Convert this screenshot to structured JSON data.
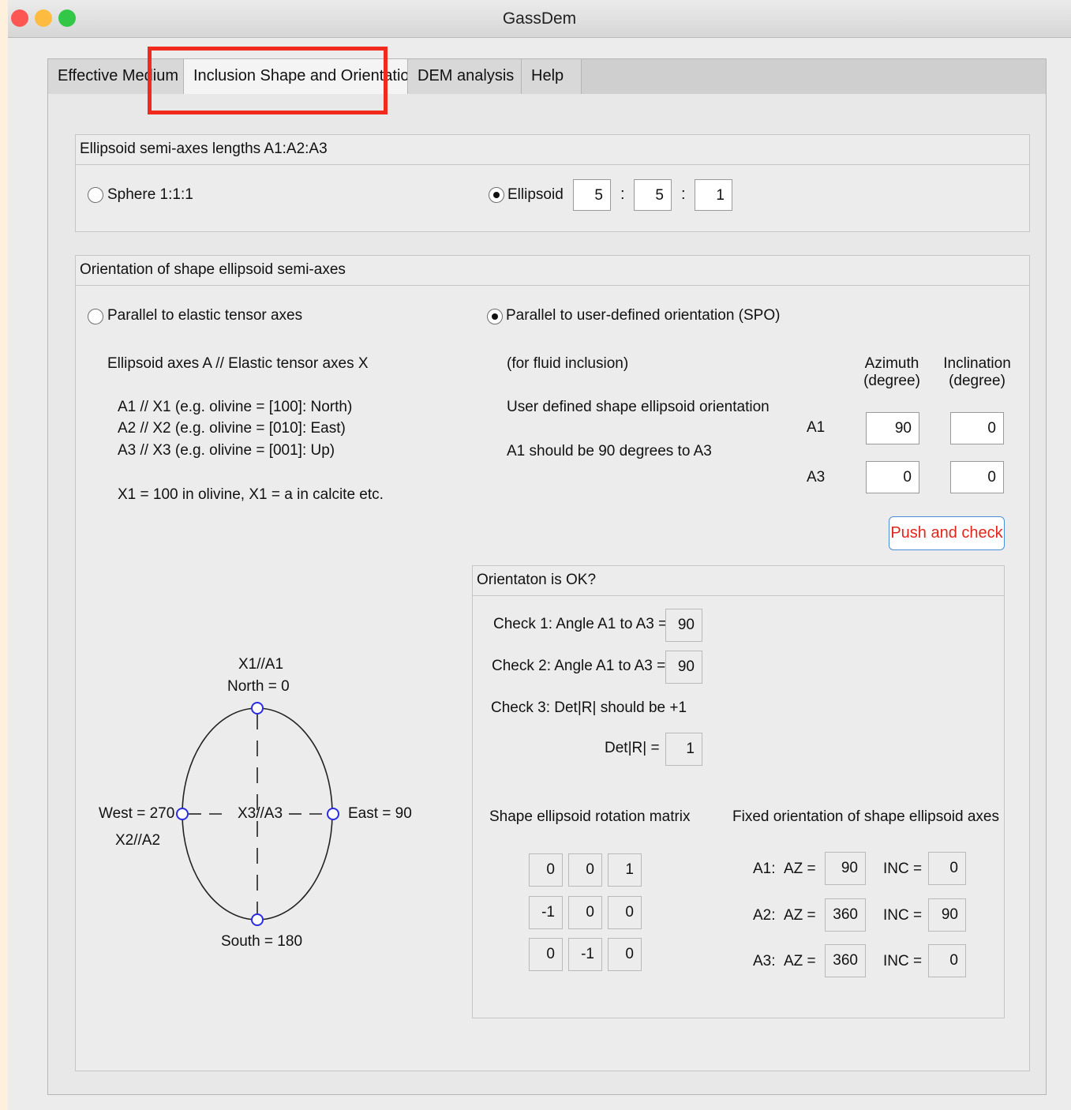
{
  "window": {
    "title": "GassDem",
    "traffic_lights": {
      "close": "#fc5753",
      "minimize": "#fdbc40",
      "zoom": "#33c748"
    }
  },
  "tabs": [
    {
      "label": "Effective Medium"
    },
    {
      "label": "Inclusion Shape and Orientation"
    },
    {
      "label": "DEM analysis"
    },
    {
      "label": "Help"
    }
  ],
  "active_tab": "Inclusion Shape and Orientation",
  "highlight_color": "#f02a1c",
  "semi_axes": {
    "heading": "Ellipsoid semi-axes lengths A1:A2:A3",
    "sphere_label": "Sphere 1:1:1",
    "sphere_selected": false,
    "ellipsoid_label": "Ellipsoid",
    "ellipsoid_selected": true,
    "a1": "5",
    "a2": "5",
    "a3": "1",
    "separator": ":"
  },
  "orientation": {
    "heading": "Orientation of shape ellipsoid semi-axes",
    "elastic": {
      "label": "Parallel to elastic tensor axes",
      "selected": false,
      "line1": "Ellipsoid axes A // Elastic tensor axes X",
      "line2": "A1 // X1 (e.g. olivine = [100]: North)",
      "line3": "A2 // X2 (e.g. olivine = [010]: East)",
      "line4": "A3 // X3 (e.g. olivine = [001]: Up)",
      "line5": "X1 = 100 in olivine, X1 = a in calcite etc."
    },
    "spo": {
      "label": "Parallel to user-defined orientation (SPO)",
      "selected": true,
      "note1": "(for fluid inclusion)",
      "note2": "User defined shape ellipsoid orientation",
      "note3": "A1 should be 90 degrees to A3",
      "azimuth_header_1": "Azimuth",
      "azimuth_header_2": "(degree)",
      "inclination_header_1": "Inclination",
      "inclination_header_2": "(degree)",
      "row_a1_label": "A1",
      "row_a3_label": "A3",
      "a1_azimuth": "90",
      "a1_inclination": "0",
      "a3_azimuth": "0",
      "a3_inclination": "0",
      "button_label": "Push and check"
    },
    "diagram": {
      "north_axis": "X1//A1",
      "north": "North = 0",
      "center": "X3//A3",
      "west": "West = 270",
      "west_axis": "X2//A2",
      "east": "East = 90",
      "south": "South = 180"
    },
    "check": {
      "heading": "Orientaton is OK?",
      "check1_label": "Check 1: Angle A1 to A3 =",
      "check1_value": "90",
      "check2_label": "Check 2: Angle A1 to A3 =",
      "check2_value": "90",
      "check3_label": "Check 3: Det|R| should be +1",
      "det_label": "Det|R| =",
      "det_value": "1",
      "matrix_heading": "Shape ellipsoid rotation matrix",
      "matrix": [
        [
          "0",
          "0",
          "1"
        ],
        [
          "-1",
          "0",
          "0"
        ],
        [
          "0",
          "-1",
          "0"
        ]
      ],
      "fixed_heading": "Fixed orientation of shape ellipsoid axes",
      "az_label": "AZ =",
      "inc_label": "INC =",
      "fixed": [
        {
          "axis": "A1:",
          "az": "90",
          "inc": "0"
        },
        {
          "axis": "A2:",
          "az": "360",
          "inc": "90"
        },
        {
          "axis": "A3:",
          "az": "360",
          "inc": "0"
        }
      ]
    }
  }
}
